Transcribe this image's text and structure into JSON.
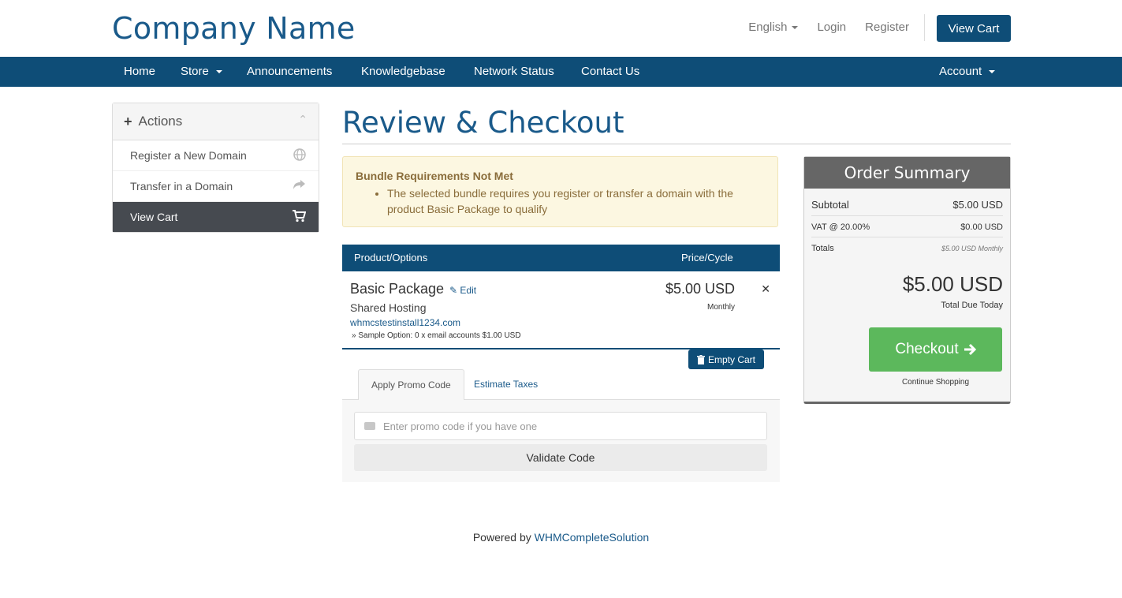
{
  "header": {
    "logo": "Company Name",
    "language": "English",
    "login": "Login",
    "register": "Register",
    "view_cart": "View Cart"
  },
  "nav": {
    "home": "Home",
    "store": "Store",
    "announcements": "Announcements",
    "knowledgebase": "Knowledgebase",
    "network_status": "Network Status",
    "contact": "Contact Us",
    "account": "Account"
  },
  "sidebar": {
    "title": "Actions",
    "items": [
      {
        "label": "Register a New Domain",
        "icon": "globe-icon"
      },
      {
        "label": "Transfer in a Domain",
        "icon": "share-icon"
      },
      {
        "label": "View Cart",
        "icon": "cart-icon",
        "active": true
      }
    ]
  },
  "main": {
    "title": "Review & Checkout",
    "alert": {
      "title": "Bundle Requirements Not Met",
      "message": "The selected bundle requires you register or transfer a domain with the product Basic Package to qualify"
    },
    "table": {
      "col_product": "Product/Options",
      "col_price": "Price/Cycle",
      "item": {
        "name": "Basic Package",
        "edit": "Edit",
        "group": "Shared Hosting",
        "domain": "whmcstestinstall1234.com",
        "option": "» Sample Option: 0 x email accounts $1.00 USD",
        "price": "$5.00 USD",
        "cycle": "Monthly"
      },
      "empty_cart": "Empty Cart"
    },
    "tabs": {
      "promo": "Apply Promo Code",
      "taxes": "Estimate Taxes"
    },
    "promo": {
      "placeholder": "Enter promo code if you have one",
      "validate": "Validate Code"
    }
  },
  "summary": {
    "title": "Order Summary",
    "subtotal_label": "Subtotal",
    "subtotal_value": "$5.00 USD",
    "vat_label": "VAT @ 20.00%",
    "vat_value": "$0.00 USD",
    "totals_label": "Totals",
    "totals_value": "$5.00 USD Monthly",
    "total_due": "$5.00 USD",
    "total_due_label": "Total Due Today",
    "checkout": "Checkout",
    "continue": "Continue Shopping"
  },
  "footer": {
    "prefix": "Powered by",
    "link": "WHMCompleteSolution"
  },
  "colors": {
    "brand": "#0e4d77",
    "checkout": "#5cb85c",
    "alert_bg": "#fcf7e1"
  }
}
